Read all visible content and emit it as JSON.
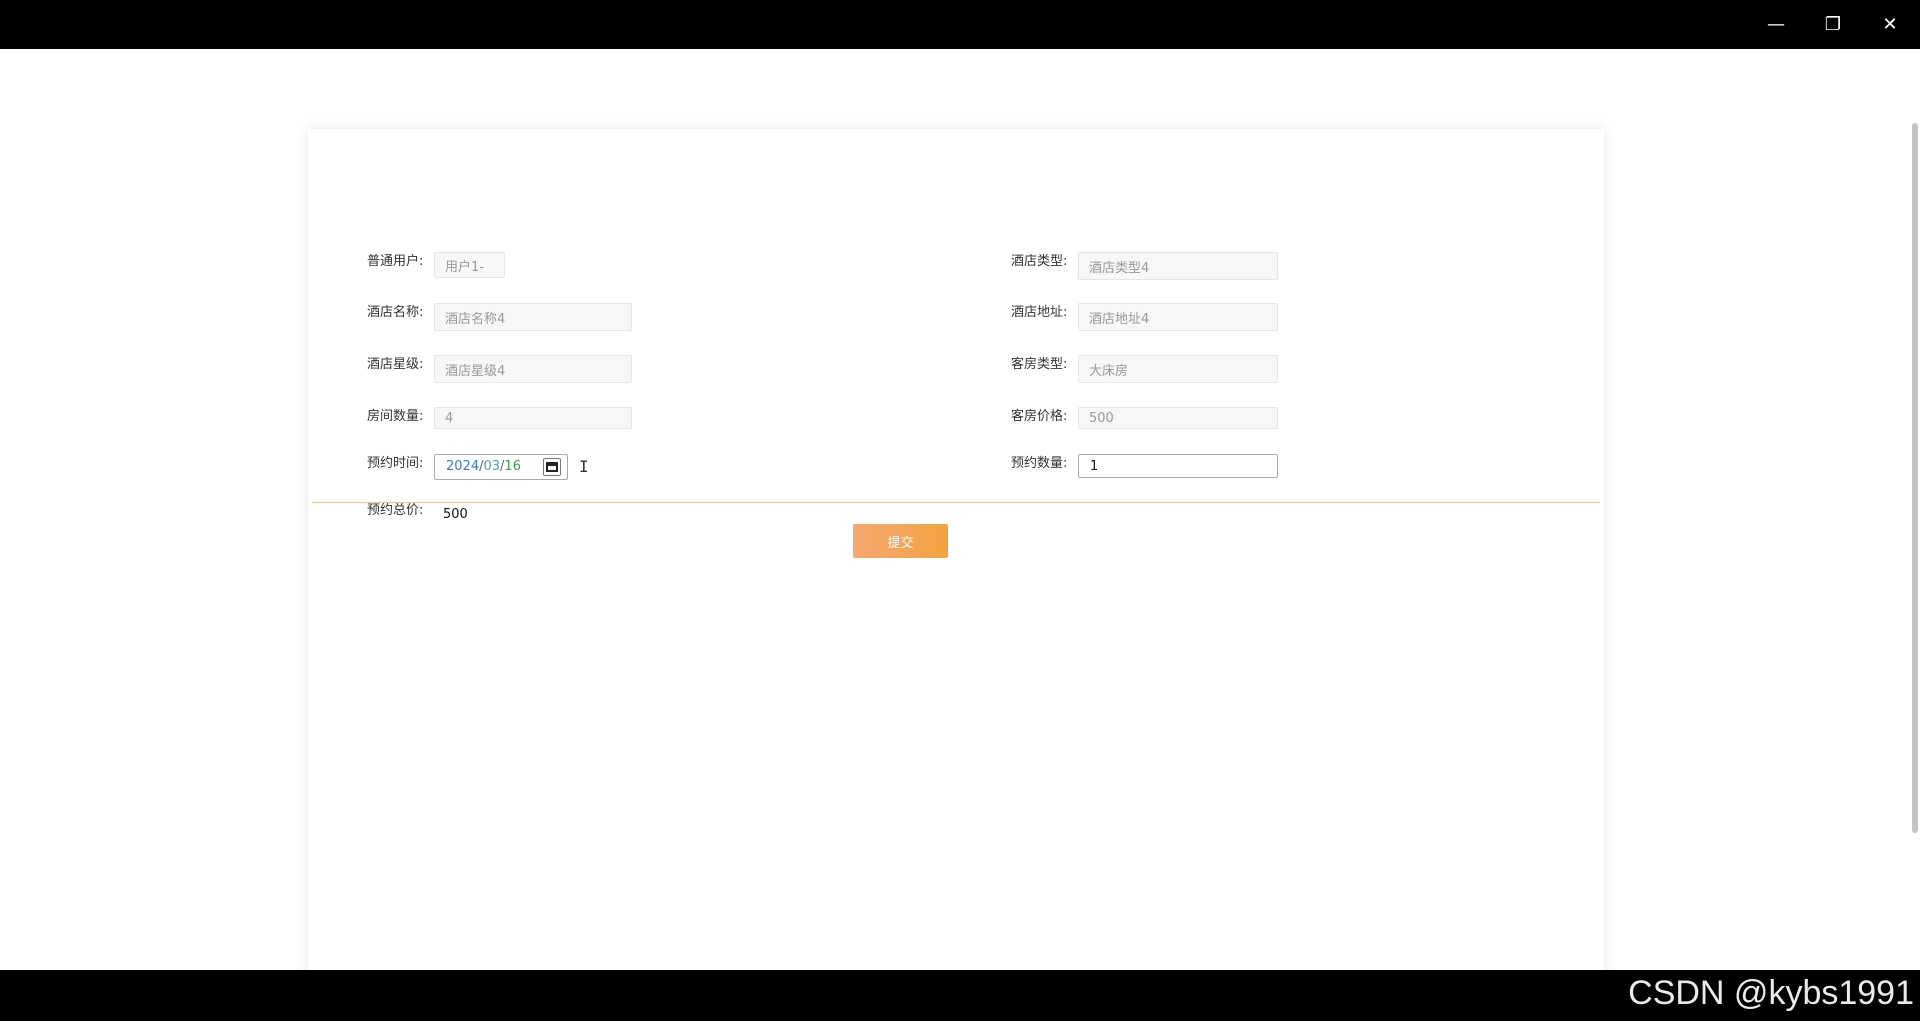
{
  "window": {
    "minimize_glyph": "—",
    "restore_glyph": "❐",
    "close_glyph": "✕"
  },
  "form": {
    "fields": [
      {
        "label": "普通用户:",
        "value": "用户1-"
      },
      {
        "label": "酒店类型:",
        "value": "酒店类型4"
      },
      {
        "label": "酒店名称:",
        "value": "酒店名称4"
      },
      {
        "label": "酒店地址:",
        "value": "酒店地址4"
      },
      {
        "label": "酒店星级:",
        "value": "酒店星级4"
      },
      {
        "label": "客房类型:",
        "value": "大床房"
      },
      {
        "label": "房间数量:",
        "value": "4"
      },
      {
        "label": "客房价格:",
        "value": "500"
      },
      {
        "label": "预约时间:",
        "date": {
          "year": "2024",
          "month": "03",
          "day": "16",
          "sep": "/"
        }
      },
      {
        "label": "预约数量:",
        "value": "1"
      },
      {
        "label": "预约总价:",
        "value": "500"
      }
    ],
    "submit_label": "提交"
  },
  "watermark": "CSDN @kybs1991",
  "colors": {
    "accent": "#f2a341",
    "divider": "#e8c7a6"
  }
}
